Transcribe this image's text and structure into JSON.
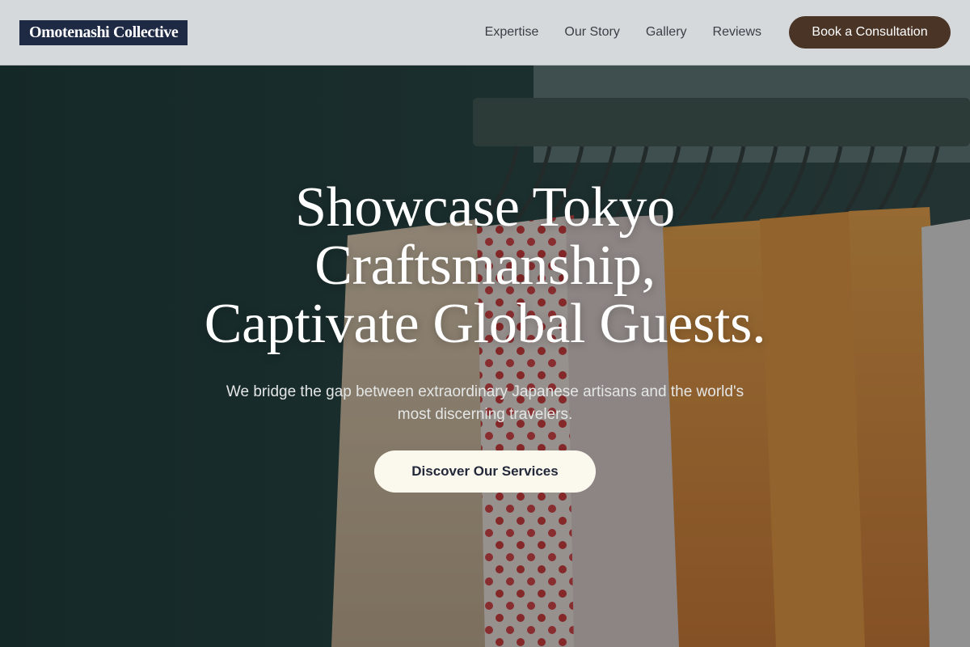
{
  "brand": {
    "logo_text": "Omotenashi Collective"
  },
  "nav": {
    "links": [
      "Expertise",
      "Our Story",
      "Gallery",
      "Reviews"
    ],
    "cta_label": "Book a Consultation"
  },
  "hero": {
    "headline_line1": "Showcase Tokyo",
    "headline_line2": "Craftsmanship,",
    "headline_line3": "Captivate Global Guests.",
    "subtext": "We bridge the gap between extraordinary Japanese artisans and the world's most discerning travelers.",
    "cta_label": "Discover Our Services",
    "background_image": "clothing-rack-photo"
  },
  "colors": {
    "header_bg": "#d6d9db",
    "logo_bg": "#1e2a44",
    "nav_cta_bg": "#4a3426",
    "hero_cta_bg": "#fbf8ee"
  }
}
